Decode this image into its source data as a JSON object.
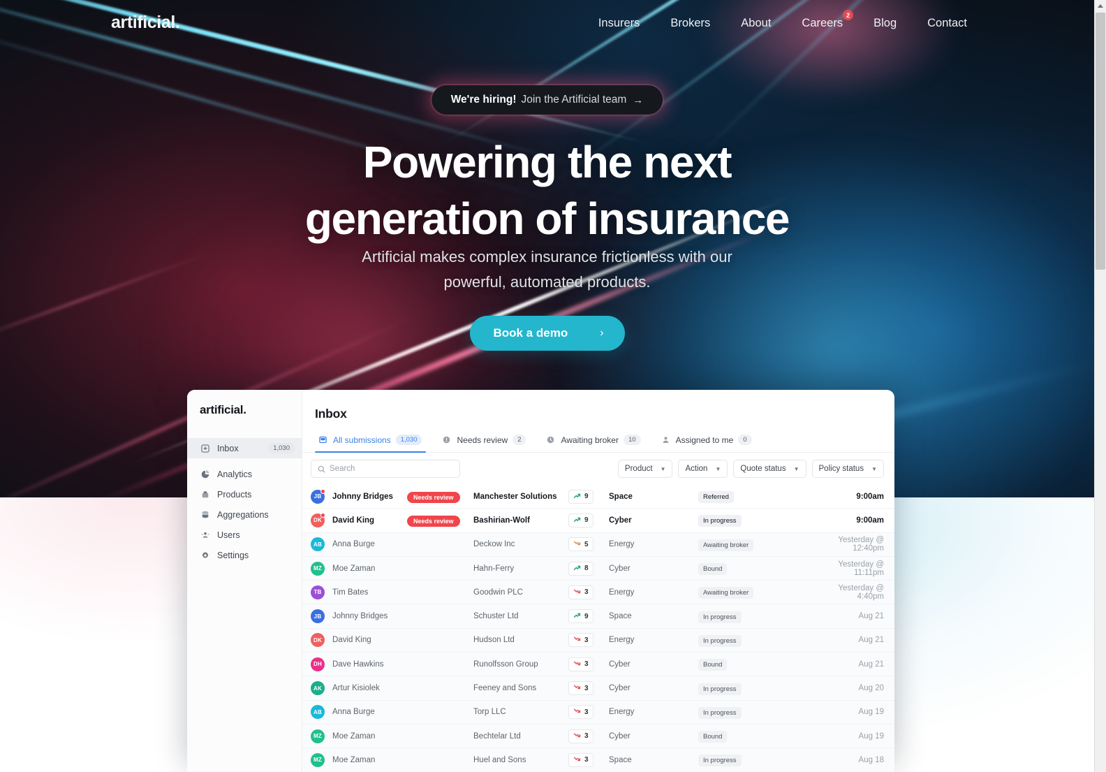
{
  "site": {
    "brand": "artificial.",
    "nav": [
      {
        "label": "Insurers"
      },
      {
        "label": "Brokers"
      },
      {
        "label": "About"
      },
      {
        "label": "Careers",
        "badge": "2"
      },
      {
        "label": "Blog"
      },
      {
        "label": "Contact"
      }
    ],
    "hiring_banner": {
      "strong": "We're hiring!",
      "rest": "Join the Artificial team",
      "arrow": "→"
    },
    "hero": {
      "title_line1": "Powering the next",
      "title_line2": "generation of insurance",
      "subtitle_line1": "Artificial makes complex insurance frictionless with our",
      "subtitle_line2": "powerful, automated products.",
      "cta_label": "Book a demo",
      "cta_chevron": "›"
    },
    "accent_color": "#23b6cd",
    "badge_color": "#e04b56"
  },
  "app": {
    "brand": "artificial.",
    "sidebar": [
      {
        "label": "Inbox",
        "icon": "inbox-icon",
        "badge": "1,030",
        "active": true
      },
      {
        "label": "Analytics",
        "icon": "pie-chart-icon",
        "badge": "",
        "active": false
      },
      {
        "label": "Products",
        "icon": "box-icon",
        "badge": "",
        "active": false
      },
      {
        "label": "Aggregations",
        "icon": "database-icon",
        "badge": "",
        "active": false
      },
      {
        "label": "Users",
        "icon": "users-icon",
        "badge": "",
        "active": false
      },
      {
        "label": "Settings",
        "icon": "gear-icon",
        "badge": "",
        "active": false
      }
    ],
    "page_title": "Inbox",
    "tabs": [
      {
        "label": "All submissions",
        "count": "1,030",
        "icon": "inbox-tab-icon",
        "active": true
      },
      {
        "label": "Needs review",
        "count": "2",
        "icon": "alert-icon",
        "active": false
      },
      {
        "label": "Awaiting broker",
        "count": "10",
        "icon": "clock-icon",
        "active": false
      },
      {
        "label": "Assigned to me",
        "count": "0",
        "icon": "person-icon",
        "active": false
      }
    ],
    "search": {
      "placeholder": "Search",
      "value": ""
    },
    "filters": [
      {
        "label": "Product"
      },
      {
        "label": "Action"
      },
      {
        "label": "Quote status"
      },
      {
        "label": "Policy status"
      }
    ],
    "rows": [
      {
        "initials": "JB",
        "color": "#3b6fe0",
        "dot": true,
        "unread": true,
        "name": "Johnny Bridges",
        "badge": "Needs review",
        "company": "Manchester Solutions",
        "score": "9",
        "trend": "up",
        "product": "Space",
        "status": "Referred",
        "time": "9:00am"
      },
      {
        "initials": "DK",
        "color": "#f0605e",
        "dot": true,
        "unread": true,
        "name": "David King",
        "badge": "Needs review",
        "company": "Bashirian-Wolf",
        "score": "9",
        "trend": "up",
        "product": "Cyber",
        "status": "In progress",
        "time": "9:00am"
      },
      {
        "initials": "AB",
        "color": "#19b9d8",
        "dot": false,
        "unread": false,
        "name": "Anna Burge",
        "badge": "",
        "company": "Deckow Inc",
        "score": "5",
        "trend": "down-orange",
        "product": "Energy",
        "status": "Awaiting broker",
        "time": "Yesterday @ 12:40pm"
      },
      {
        "initials": "MZ",
        "color": "#22c08a",
        "dot": false,
        "unread": false,
        "name": "Moe Zaman",
        "badge": "",
        "company": "Hahn-Ferry",
        "score": "8",
        "trend": "up",
        "product": "Cyber",
        "status": "Bound",
        "time": "Yesterday @ 11:11pm"
      },
      {
        "initials": "TB",
        "color": "#9a4fd6",
        "dot": false,
        "unread": false,
        "name": "Tim Bates",
        "badge": "",
        "company": "Goodwin PLC",
        "score": "3",
        "trend": "down-red",
        "product": "Energy",
        "status": "Awaiting broker",
        "time": "Yesterday @ 4:40pm"
      },
      {
        "initials": "JB",
        "color": "#3b6fe0",
        "dot": false,
        "unread": false,
        "name": "Johnny Bridges",
        "badge": "",
        "company": "Schuster Ltd",
        "score": "9",
        "trend": "up",
        "product": "Space",
        "status": "In progress",
        "time": "Aug 21"
      },
      {
        "initials": "DK",
        "color": "#f0605e",
        "dot": false,
        "unread": false,
        "name": "David King",
        "badge": "",
        "company": "Hudson Ltd",
        "score": "3",
        "trend": "down-red",
        "product": "Energy",
        "status": "In progress",
        "time": "Aug 21"
      },
      {
        "initials": "DH",
        "color": "#e8308a",
        "dot": false,
        "unread": false,
        "name": "Dave Hawkins",
        "badge": "",
        "company": "Runolfsson Group",
        "score": "3",
        "trend": "down-red",
        "product": "Cyber",
        "status": "Bound",
        "time": "Aug 21"
      },
      {
        "initials": "AK",
        "color": "#1bae8a",
        "dot": false,
        "unread": false,
        "name": "Artur Kisiolek",
        "badge": "",
        "company": "Feeney and Sons",
        "score": "3",
        "trend": "down-red",
        "product": "Cyber",
        "status": "In progress",
        "time": "Aug 20"
      },
      {
        "initials": "AB",
        "color": "#19b9d8",
        "dot": false,
        "unread": false,
        "name": "Anna Burge",
        "badge": "",
        "company": "Torp LLC",
        "score": "3",
        "trend": "down-red",
        "product": "Energy",
        "status": "In progress",
        "time": "Aug 19"
      },
      {
        "initials": "MZ",
        "color": "#22c08a",
        "dot": false,
        "unread": false,
        "name": "Moe Zaman",
        "badge": "",
        "company": "Bechtelar Ltd",
        "score": "3",
        "trend": "down-red",
        "product": "Cyber",
        "status": "Bound",
        "time": "Aug 19"
      },
      {
        "initials": "MZ",
        "color": "#22c08a",
        "dot": false,
        "unread": false,
        "name": "Moe Zaman",
        "badge": "",
        "company": "Huel and Sons",
        "score": "3",
        "trend": "down-red",
        "product": "Space",
        "status": "In progress",
        "time": "Aug 18"
      }
    ]
  }
}
